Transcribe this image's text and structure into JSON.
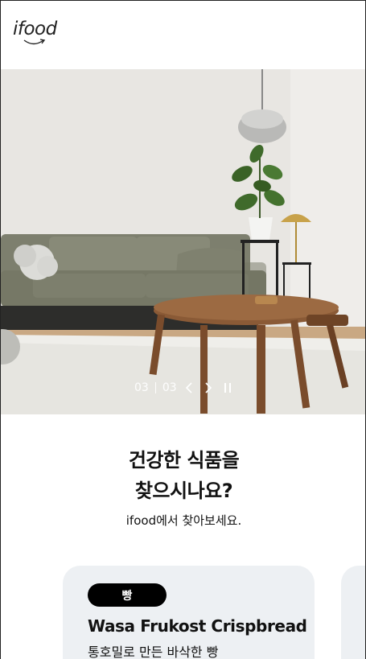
{
  "header": {
    "logo_text": "ifood"
  },
  "hero": {
    "slide_current": "03",
    "slide_total": "03",
    "prev_icon": "chevron-left-icon",
    "next_icon": "chevron-right-icon",
    "pause_icon": "pause-icon"
  },
  "main": {
    "headline_line1": "건강한 식품을",
    "headline_line2": "찾으시나요?",
    "subline": "ifood에서 찾아보세요."
  },
  "product_cards": [
    {
      "badge": "빵",
      "title": "Wasa Frukost Crispbread",
      "description": "통호밀로 만든 바삭한 빵"
    }
  ],
  "colors": {
    "card_bg": "#edf0f3",
    "badge_bg": "#000000",
    "text": "#111111"
  }
}
